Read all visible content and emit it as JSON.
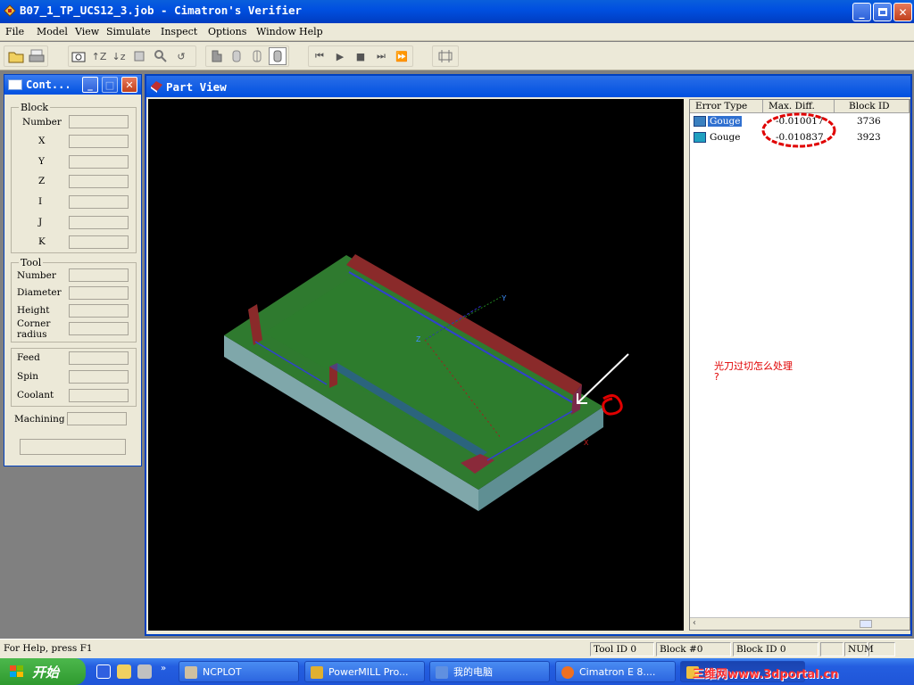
{
  "window": {
    "title": "B07_1_TP_UCS12_3.job - Cimatron's Verifier"
  },
  "menu": [
    "File",
    "Model",
    "View",
    "Simulate",
    "Inspect",
    "Options",
    "Window",
    "Help"
  ],
  "control_panel": {
    "title": "Cont...",
    "block_group": {
      "label": "Block",
      "fields": [
        "Number",
        "X",
        "Y",
        "Z",
        "I",
        "J",
        "K"
      ]
    },
    "tool_group": {
      "label": "Tool",
      "fields": [
        "Number",
        "Diameter",
        "Height",
        "Corner radius"
      ]
    },
    "feed_group": {
      "fields": [
        "Feed",
        "Spin",
        "Coolant"
      ]
    },
    "machining_label": "Machining"
  },
  "part_view": {
    "title": "Part View",
    "axes": {
      "y": "Y",
      "z": "Z",
      "x": "X"
    },
    "error_table": {
      "headers": [
        "Error Type",
        "Max. Diff.",
        "Block ID"
      ],
      "rows": [
        {
          "type": "Gouge",
          "diff": "-0.010017",
          "block": "3736"
        },
        {
          "type": "Gouge",
          "diff": "-0.010837",
          "block": "3923"
        }
      ]
    },
    "annotation": {
      "line1": "光刀过切怎么处理",
      "line2": "?"
    }
  },
  "statusbar": {
    "help": "For Help, press F1",
    "tool_id": "Tool ID 0",
    "block": "Block #0",
    "block_id": "Block ID 0",
    "num": "NUM"
  },
  "taskbar": {
    "start": "开始",
    "tasks": [
      "NCPLOT",
      "PowerMILL Pro...",
      "我的电脑",
      "Cimatron E 8....",
      "B0..."
    ],
    "watermark": "三维网www.3dportal.cn"
  },
  "colors": {
    "titlebar": "#0050e0",
    "panel": "#ece9d8",
    "canvas": "#000000",
    "annotation": "#e00000"
  }
}
